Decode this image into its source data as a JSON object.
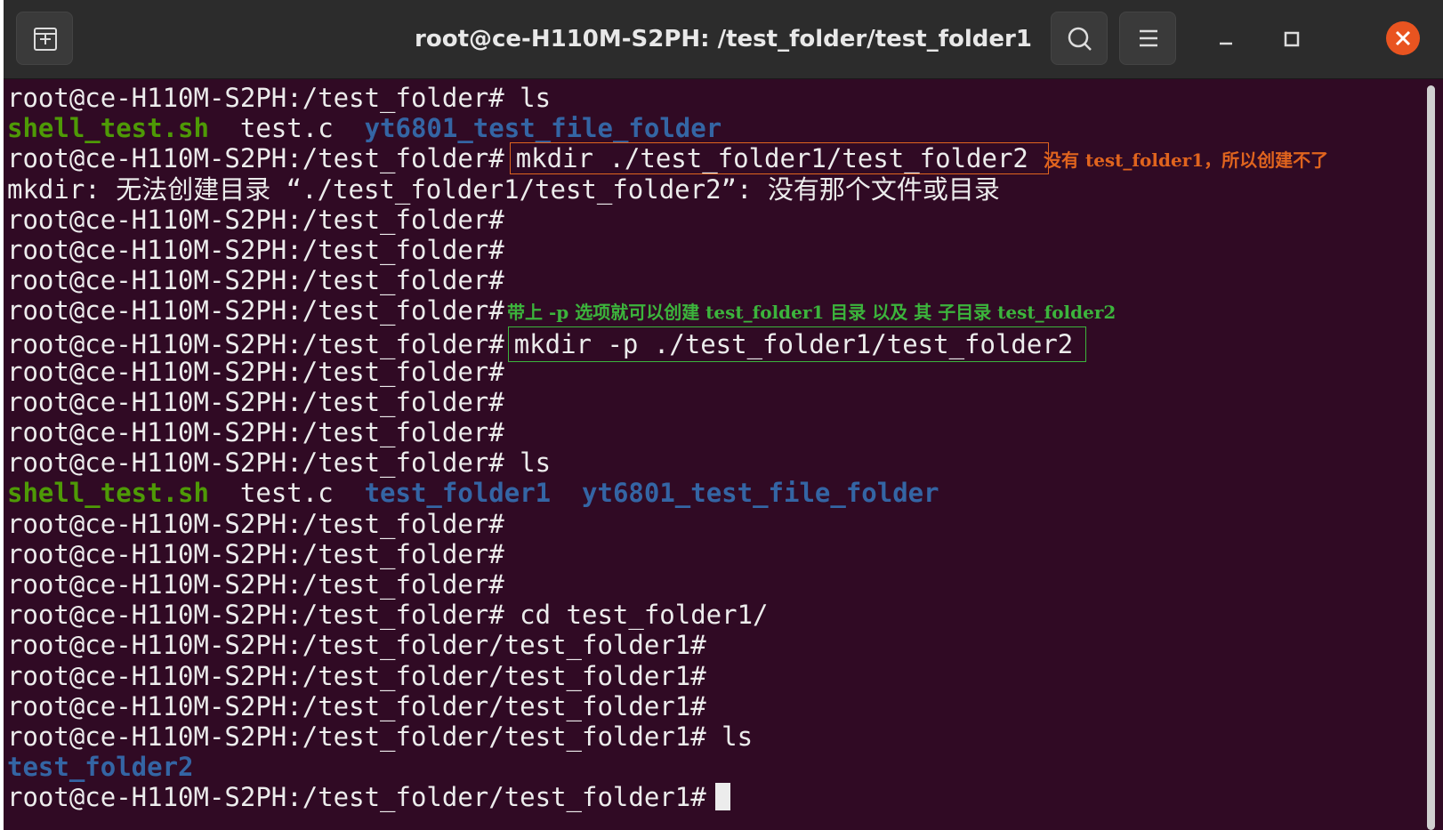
{
  "window": {
    "title": "root@ce-H110M-S2PH: /test_folder/test_folder1",
    "icons": {
      "new_tab": "new-tab-icon",
      "search": "search-icon",
      "menu": "hamburger-menu-icon",
      "minimize": "minimize-icon",
      "maximize": "maximize-icon",
      "close": "close-icon"
    },
    "colors": {
      "terminal_bg": "#300a24",
      "titlebar_bg": "#2c2c2c",
      "executable": "#4e9a06",
      "directory": "#3465a4",
      "close": "#e95420",
      "annotation_red": "#e0641e",
      "annotation_green": "#3cb43c"
    }
  },
  "terminal": {
    "prompt_root": "root@ce-H110M-S2PH:/test_folder#",
    "prompt_sub": "root@ce-H110M-S2PH:/test_folder/test_folder1#",
    "cmd_ls": " ls",
    "cmd_mkdir": "mkdir ./test_folder1/test_folder2",
    "cmd_mkdir_p": "mkdir -p ./test_folder1/test_folder2",
    "cmd_cd": " cd test_folder1/",
    "error": "mkdir: 无法创建目录 “./test_folder1/test_folder2”: 没有那个文件或目录",
    "ls1": {
      "shell": "shell_test.sh",
      "testc": "test.c",
      "yt": "yt6801_test_file_folder"
    },
    "ls2": {
      "shell": "shell_test.sh",
      "testc": "test.c",
      "folder1": "test_folder1",
      "yt": "yt6801_test_file_folder"
    },
    "ls3": {
      "folder2": "test_folder2"
    }
  },
  "annotations": {
    "red_note": "没有 test_folder1，所以创建不了",
    "green_note": "带上 -p 选项就可以创建 test_folder1 目录 以及 其 子目录 test_folder2"
  }
}
